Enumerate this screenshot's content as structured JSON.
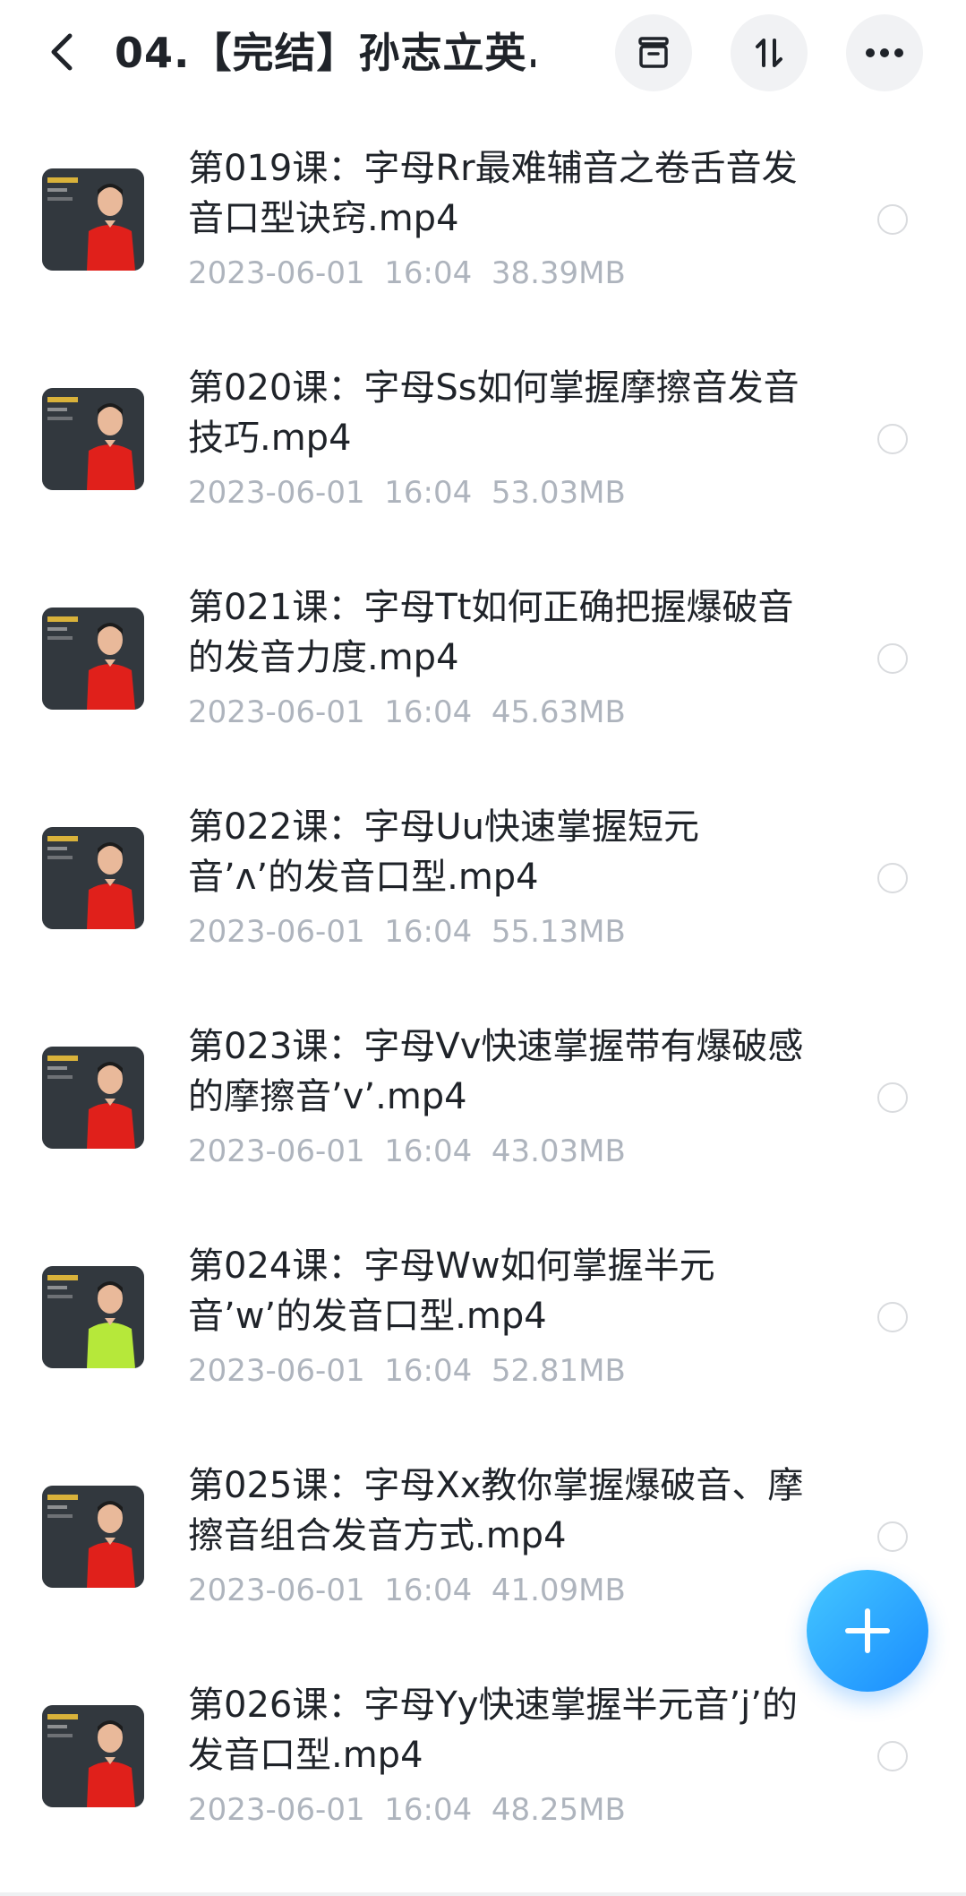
{
  "header": {
    "title": "04.【完结】孙志立英...",
    "back_icon": "chevron-left-icon",
    "archive_icon": "archive-icon",
    "sort_icon": "sort-icon",
    "more_icon": "more-horizontal-icon"
  },
  "files": [
    {
      "name": "第019课：字母Rr最难辅音之卷舌音发音口型诀窍.mp4",
      "date": "2023-06-01",
      "time": "16:04",
      "size": "38.39MB",
      "shirt": "#e0201b"
    },
    {
      "name": "第020课：字母Ss如何掌握摩擦音发音技巧.mp4",
      "date": "2023-06-01",
      "time": "16:04",
      "size": "53.03MB",
      "shirt": "#e0201b"
    },
    {
      "name": "第021课：字母Tt如何正确把握爆破音的发音力度.mp4",
      "date": "2023-06-01",
      "time": "16:04",
      "size": "45.63MB",
      "shirt": "#e0201b"
    },
    {
      "name": "第022课：字母Uu快速掌握短元音’ʌ’的发音口型.mp4",
      "date": "2023-06-01",
      "time": "16:04",
      "size": "55.13MB",
      "shirt": "#e0201b"
    },
    {
      "name": "第023课：字母Vv快速掌握带有爆破感的摩擦音’v’.mp4",
      "date": "2023-06-01",
      "time": "16:04",
      "size": "43.03MB",
      "shirt": "#e0201b"
    },
    {
      "name": "第024课：字母Ww如何掌握半元音’w’的发音口型.mp4",
      "date": "2023-06-01",
      "time": "16:04",
      "size": "52.81MB",
      "shirt": "#b6e83a"
    },
    {
      "name": "第025课：字母Xx教你掌握爆破音、摩擦音组合发音方式.mp4",
      "date": "2023-06-01",
      "time": "16:04",
      "size": "41.09MB",
      "shirt": "#e0201b"
    },
    {
      "name": "第026课：字母Yy快速掌握半元音’j’的发音口型.mp4",
      "date": "2023-06-01",
      "time": "16:04",
      "size": "48.25MB",
      "shirt": "#e0201b"
    }
  ],
  "fab": {
    "icon": "plus-icon"
  },
  "colors": {
    "accent": "#1a8cff",
    "meta": "#aeb4bd",
    "text": "#1f2329"
  }
}
